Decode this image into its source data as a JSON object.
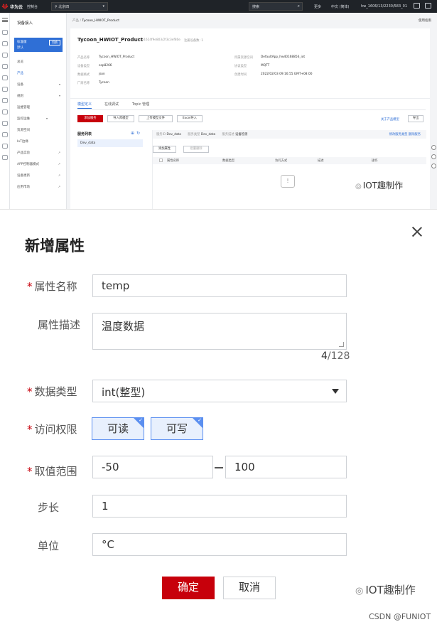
{
  "topbar": {
    "brand": "华为云",
    "console": "控制台",
    "region": "北京四",
    "search_placeholder": "搜索",
    "items": [
      "更多",
      "中文 (简体)",
      "hw_1606/13/2230/583_01"
    ]
  },
  "sidenav": {
    "title": "设备接入",
    "instance_name": "标准版",
    "instance_switch": "切换",
    "instance_sub": "默认",
    "items": [
      "总览",
      "产品",
      "设备",
      "规则",
      "运维管理",
      "监控运维",
      "资源空间",
      "IoT边缘",
      "产品实验",
      "APP控制器模式",
      "设备更新",
      "应用市场"
    ]
  },
  "breadcrumb": {
    "parent": "产品",
    "current": "Tycoon_HWIOT_Product"
  },
  "help_link": "使用指南",
  "product": {
    "name": "Tycoon_HWIOT_Product",
    "id_text": "ID: 61624f9e803/2f3c3ef80e",
    "device_count_text": "注册设备数: 1",
    "fields_left": [
      {
        "label": "产品名称",
        "value": "Tycoon_HWIOT_Product"
      },
      {
        "label": "设备类型",
        "value": "esp8266"
      },
      {
        "label": "数据格式",
        "value": "json"
      },
      {
        "label": "厂商名称",
        "value": "Tycoon"
      }
    ],
    "fields_right": [
      {
        "label": "所属资源空间",
        "value": "DefaultApp_hw40168856_iot"
      },
      {
        "label": "协议类型",
        "value": "MQTT"
      },
      {
        "label": "创建时间",
        "value": "2022/02/03 09:16:55 GMT+08:00"
      }
    ]
  },
  "tabs": [
    "模型定义",
    "在线调试",
    "Topic 管理"
  ],
  "toolbar": {
    "custom_model": "添加服务",
    "import_library": "导入库模型",
    "upload_model": "上传模型文件",
    "excel_import": "Excel导入",
    "about_model": "关于产品模型",
    "export": "导出"
  },
  "service_list": {
    "header": "服务列表",
    "items": [
      "Dev_data"
    ]
  },
  "service_meta": {
    "id_label": "服务ID",
    "id_value": "Dev_data",
    "type_label": "服务类型",
    "type_value": "Dev_data",
    "desc_label": "服务描述",
    "desc_value": "设备检测",
    "ops": "修改服务类型  删除服务"
  },
  "property_toolbar": {
    "add": "添加属性",
    "batch_delete": "批量删除"
  },
  "table_headers": [
    "属性名称",
    "数据类型",
    "访问方式",
    "描述",
    "操作"
  ],
  "watermark": {
    "text": "IOT趣制作",
    "credit": "CSDN @FUNIOT"
  },
  "dialog": {
    "title": "新增属性",
    "fields": {
      "name": {
        "label": "属性名称",
        "value": "temp"
      },
      "desc": {
        "label": "属性描述",
        "value": "温度数据",
        "counter": "4",
        "max": "/128"
      },
      "datatype": {
        "label": "数据类型",
        "value": "int(整型)"
      },
      "access": {
        "label": "访问权限",
        "options": [
          "可读",
          "可写"
        ]
      },
      "range": {
        "label": "取值范围",
        "min": "-50",
        "max": "100"
      },
      "step": {
        "label": "步长",
        "value": "1"
      },
      "unit": {
        "label": "单位",
        "value": "°C"
      }
    },
    "ok_label": "确定",
    "cancel_label": "取消"
  },
  "colors": {
    "primary_red": "#c7000b",
    "accent_blue": "#2f6fd6",
    "checked_blue": "#5b8ff0"
  }
}
